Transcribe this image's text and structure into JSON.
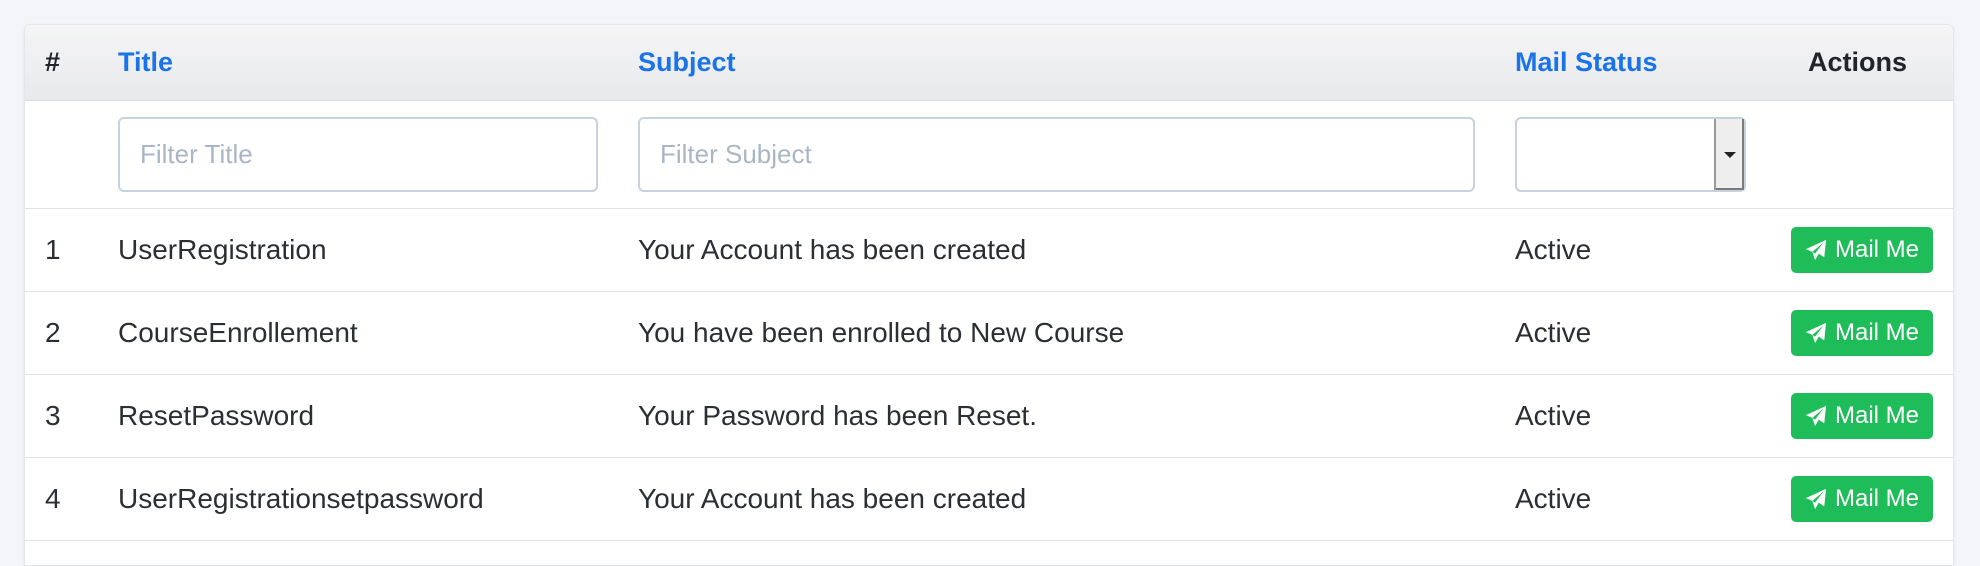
{
  "table": {
    "headers": {
      "number": "#",
      "title": "Title",
      "subject": "Subject",
      "mail_status": "Mail Status",
      "actions": "Actions"
    },
    "filters": {
      "title_placeholder": "Filter Title",
      "subject_placeholder": "Filter Subject",
      "status_selected": ""
    },
    "rows": [
      {
        "num": "1",
        "title": "UserRegistration",
        "subject": "Your Account has been created",
        "status": "Active",
        "action_label": "Mail Me"
      },
      {
        "num": "2",
        "title": "CourseEnrollement",
        "subject": "You have been enrolled to New Course",
        "status": "Active",
        "action_label": "Mail Me"
      },
      {
        "num": "3",
        "title": "ResetPassword",
        "subject": "Your Password has been Reset.",
        "status": "Active",
        "action_label": "Mail Me"
      },
      {
        "num": "4",
        "title": "UserRegistrationsetpassword",
        "subject": "Your Account has been created",
        "status": "Active",
        "action_label": "Mail Me"
      }
    ],
    "action_icon": "paper-plane-icon"
  },
  "colors": {
    "link_header": "#1a73e8",
    "action_button": "#1fbd5a",
    "page_background": "#f4f5f9"
  }
}
